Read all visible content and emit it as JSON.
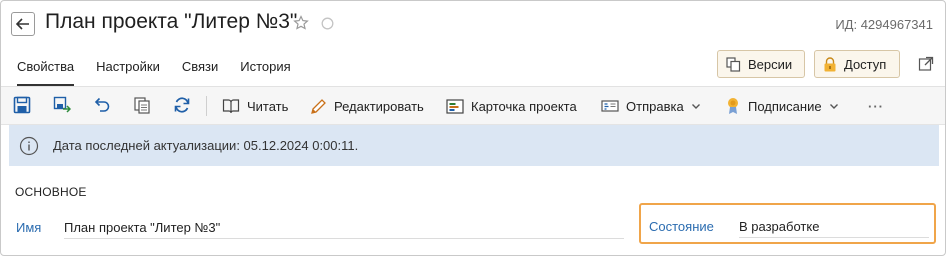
{
  "header": {
    "title": "План проекта \"Литер №3\"",
    "id_label": "ИД: 4294967341"
  },
  "tabs": [
    {
      "label": "Свойства",
      "active": true
    },
    {
      "label": "Настройки"
    },
    {
      "label": "Связи"
    },
    {
      "label": "История"
    }
  ],
  "header_buttons": {
    "versions": "Версии",
    "access": "Доступ"
  },
  "toolbar": {
    "read": "Читать",
    "edit": "Редактировать",
    "project_card": "Карточка проекта",
    "send": "Отправка",
    "sign": "Подписание",
    "more": "···"
  },
  "info": {
    "text": "Дата последней актуализации: 05.12.2024 0:00:11."
  },
  "section": {
    "title": "ОСНОВНОЕ",
    "name_label": "Имя",
    "name_value": "План проекта \"Литер №3\"",
    "state_label": "Состояние",
    "state_value": "В разработке"
  },
  "colors": {
    "accent_blue": "#2b6cb0",
    "info_bg": "#dbe6f3",
    "highlight_orange": "#f0a54a",
    "button_bg": "#fbf6ec"
  }
}
